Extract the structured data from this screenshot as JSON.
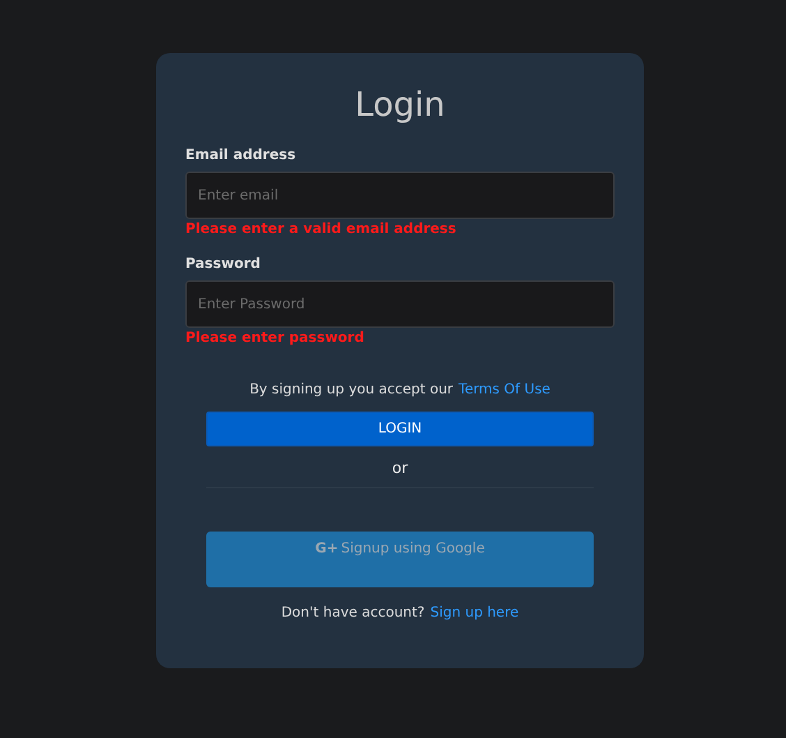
{
  "title": "Login",
  "fields": [
    {
      "label": "Email address",
      "placeholder": "Enter email",
      "error": "Please enter a valid email address"
    },
    {
      "label": "Password",
      "placeholder": "Enter Password",
      "error": "Please enter password"
    }
  ],
  "terms": {
    "text": "By signing up you accept our",
    "link": "Terms Of Use"
  },
  "login_button": "LOGIN",
  "separator": "or",
  "google_button": {
    "icon": "G+",
    "label": "Signup using Google"
  },
  "footer": {
    "text": "Don't have account?",
    "link": "Sign up here"
  }
}
